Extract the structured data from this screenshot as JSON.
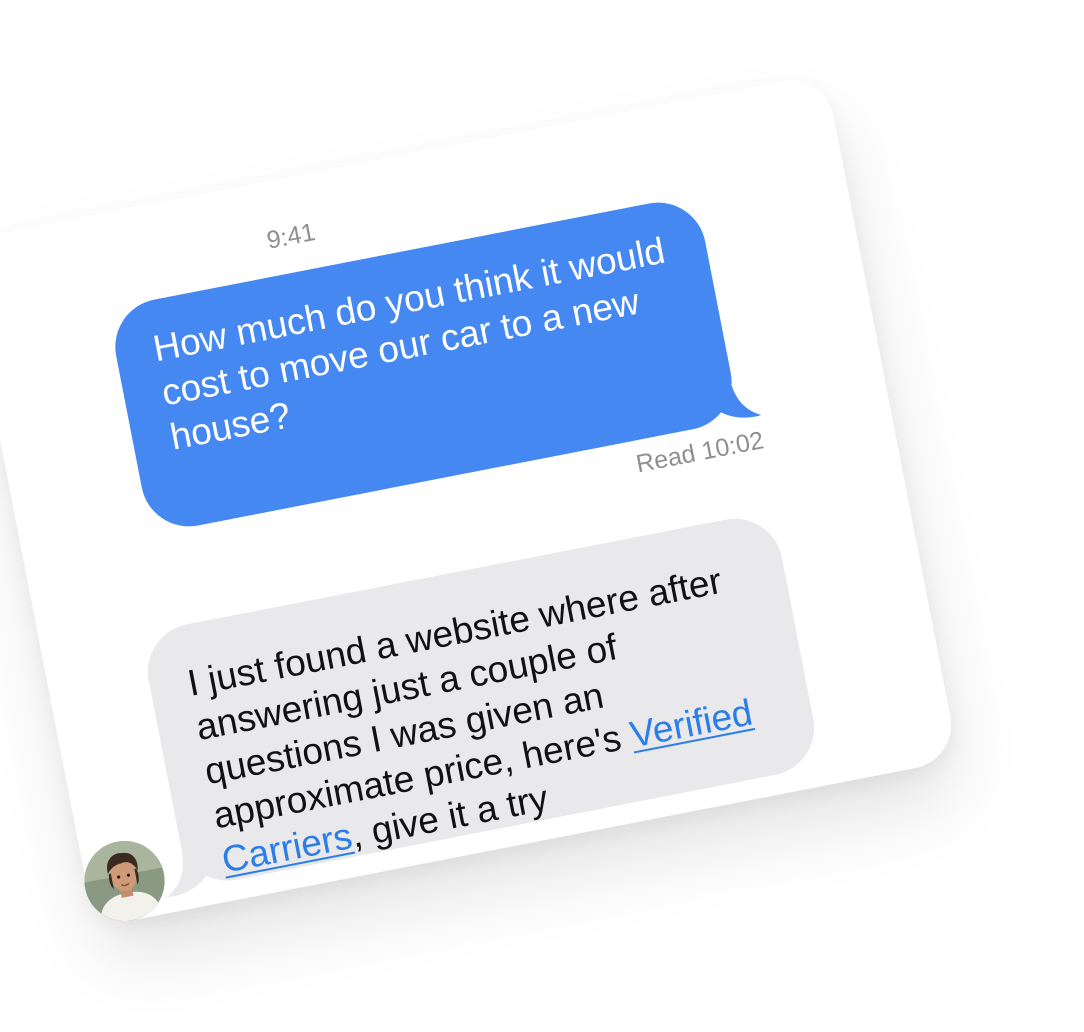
{
  "conversation": {
    "timestamp": "9:41",
    "outgoing": {
      "text": "How much do you think it would cost to move our car to a new house?",
      "read_receipt": "Read 10:02",
      "bubble_color": "#4688f1"
    },
    "incoming": {
      "text_before_link": "I just found a website where after answering just a couple of questions I was given an approximate price, here's ",
      "link_text": "Verified Carriers",
      "text_after_link": ", give it a try",
      "bubble_color": "#e9e9eb",
      "link_color": "#2b7de9"
    },
    "avatar": {
      "icon": "contact-photo"
    }
  }
}
